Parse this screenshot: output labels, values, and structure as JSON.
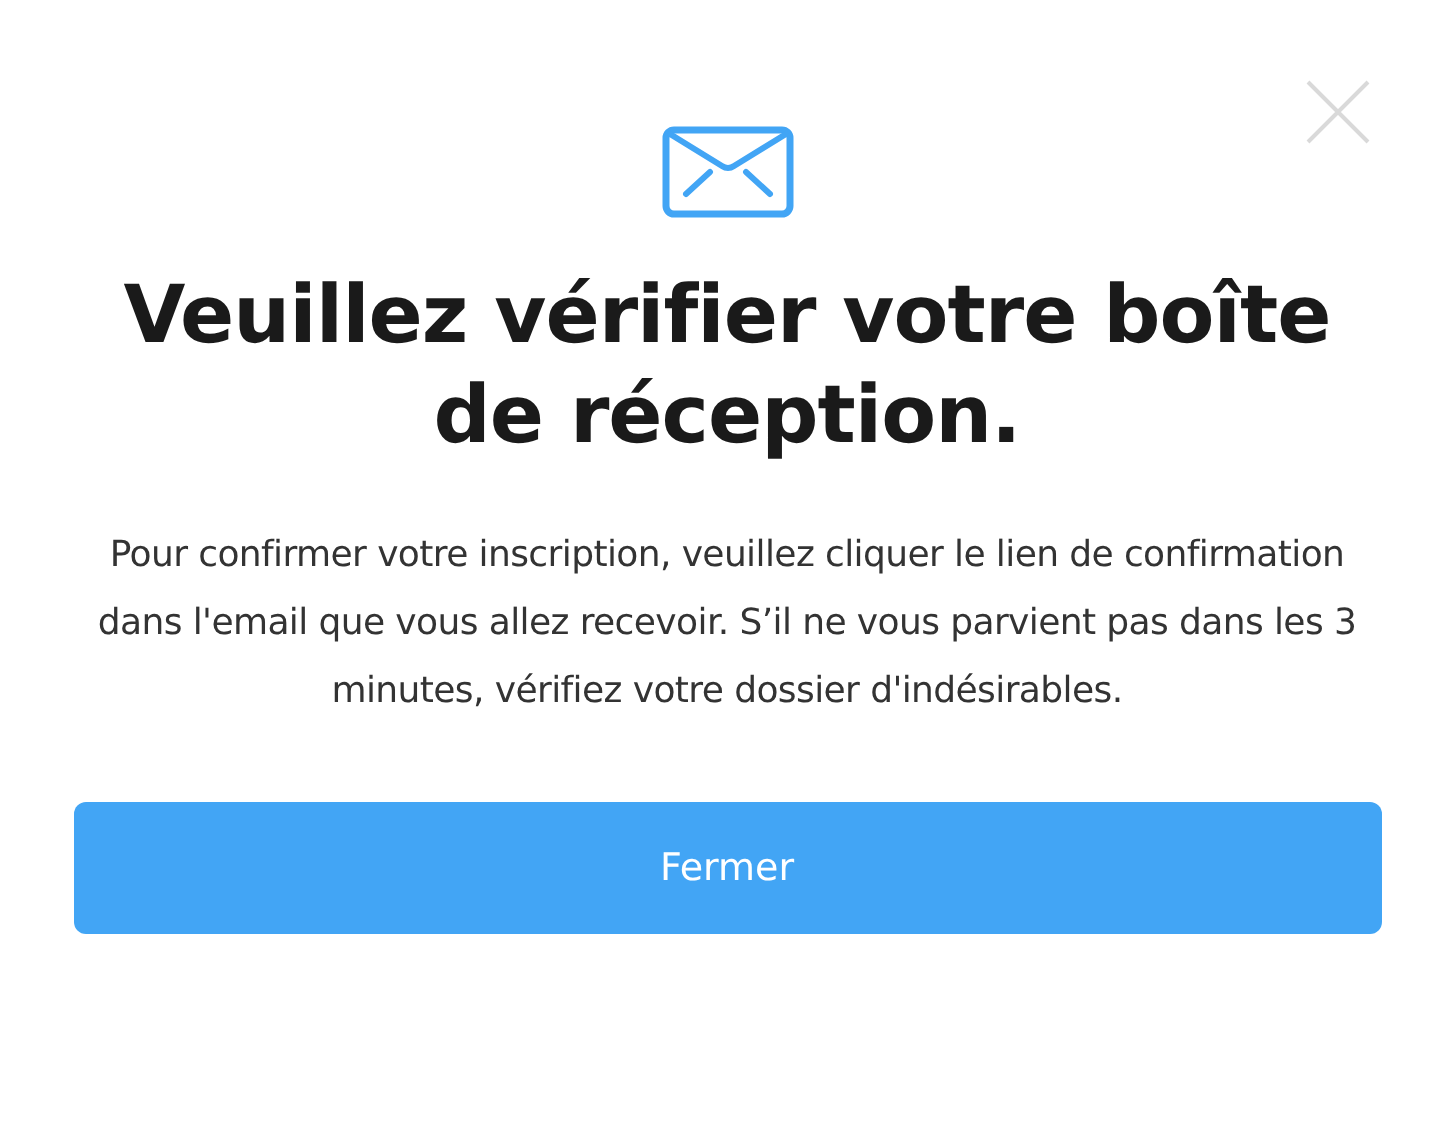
{
  "dialog": {
    "title": "Veuillez vérifier votre boîte de réception.",
    "message": "Pour confirmer votre inscription, veuillez cliquer le lien de confirmation dans l'email que vous allez recevoir. S’il ne vous parvient pas dans les 3 minutes, vérifiez votre dossier d'indésirables.",
    "button": "Fermer"
  }
}
